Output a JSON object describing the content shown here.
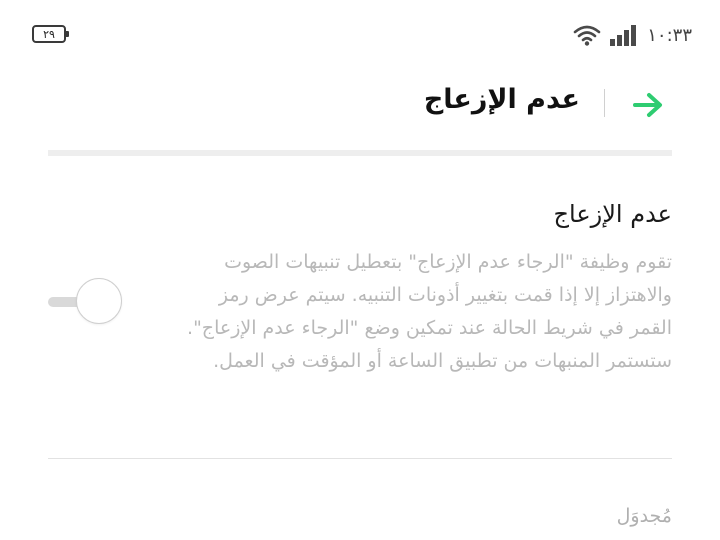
{
  "status_bar": {
    "battery_level": "٢٩",
    "time": "١٠:٣٣",
    "wifi_icon": "wifi-icon",
    "signal_icon": "cellular-signal-icon"
  },
  "header": {
    "title": "عدم الإزعاج",
    "back_icon": "arrow-right-icon",
    "accent_color": "#2ecc71"
  },
  "setting": {
    "title": "عدم الإزعاج",
    "description": "تقوم وظيفة \"الرجاء عدم الإزعاج\" بتعطيل تنبيهات الصوت والاهتزاز إلا إذا قمت بتغيير أذونات التنبيه. سيتم عرض رمز القمر في شريط الحالة عند تمكين وضع \"الرجاء عدم الإزعاج\". ستستمر المنبهات من تطبيق الساعة أو المؤقت في العمل.",
    "toggle_state": "off"
  },
  "schedule": {
    "label": "مُجدوَل"
  }
}
